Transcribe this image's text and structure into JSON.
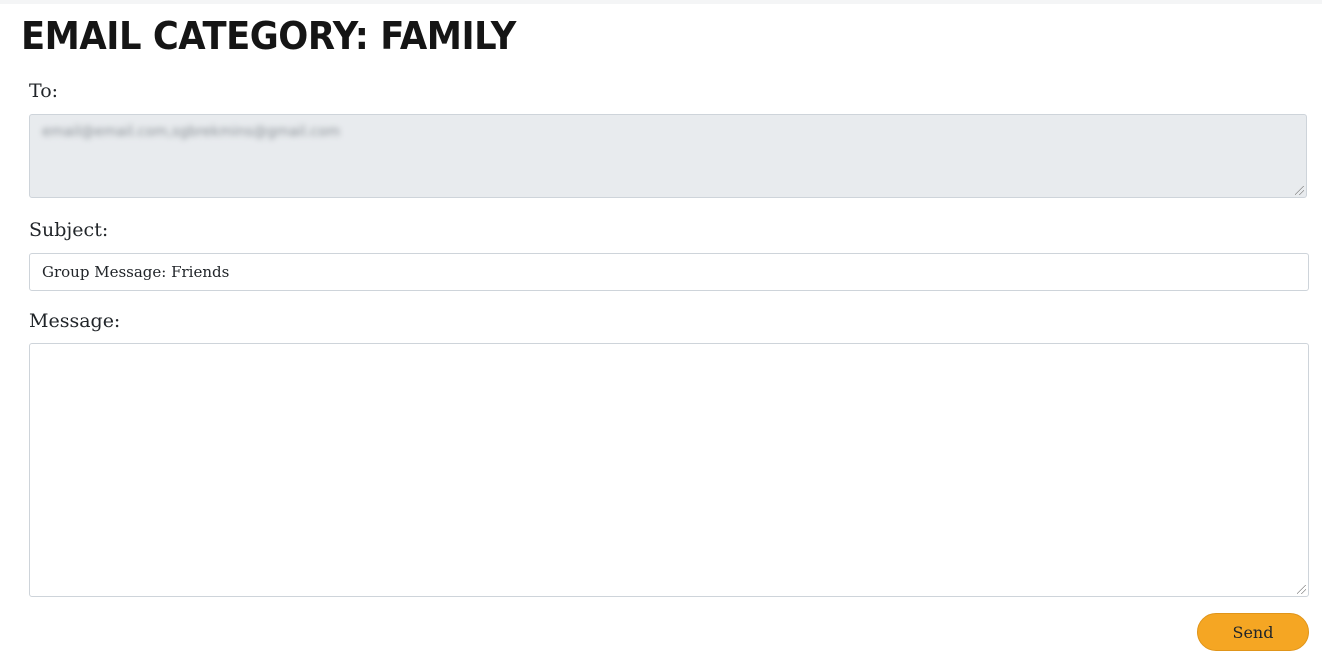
{
  "page": {
    "title": "EMAIL CATEGORY: FAMILY"
  },
  "form": {
    "to": {
      "label": "To:",
      "value": "email@email.com,sgbrekmins@gmail.com"
    },
    "subject": {
      "label": "Subject:",
      "value": "Group Message: Friends"
    },
    "message": {
      "label": "Message:",
      "value": ""
    },
    "send_label": "Send"
  },
  "colors": {
    "accent": "#f5a623",
    "readonly_background": "#e8ebee",
    "border": "#ced4da"
  }
}
